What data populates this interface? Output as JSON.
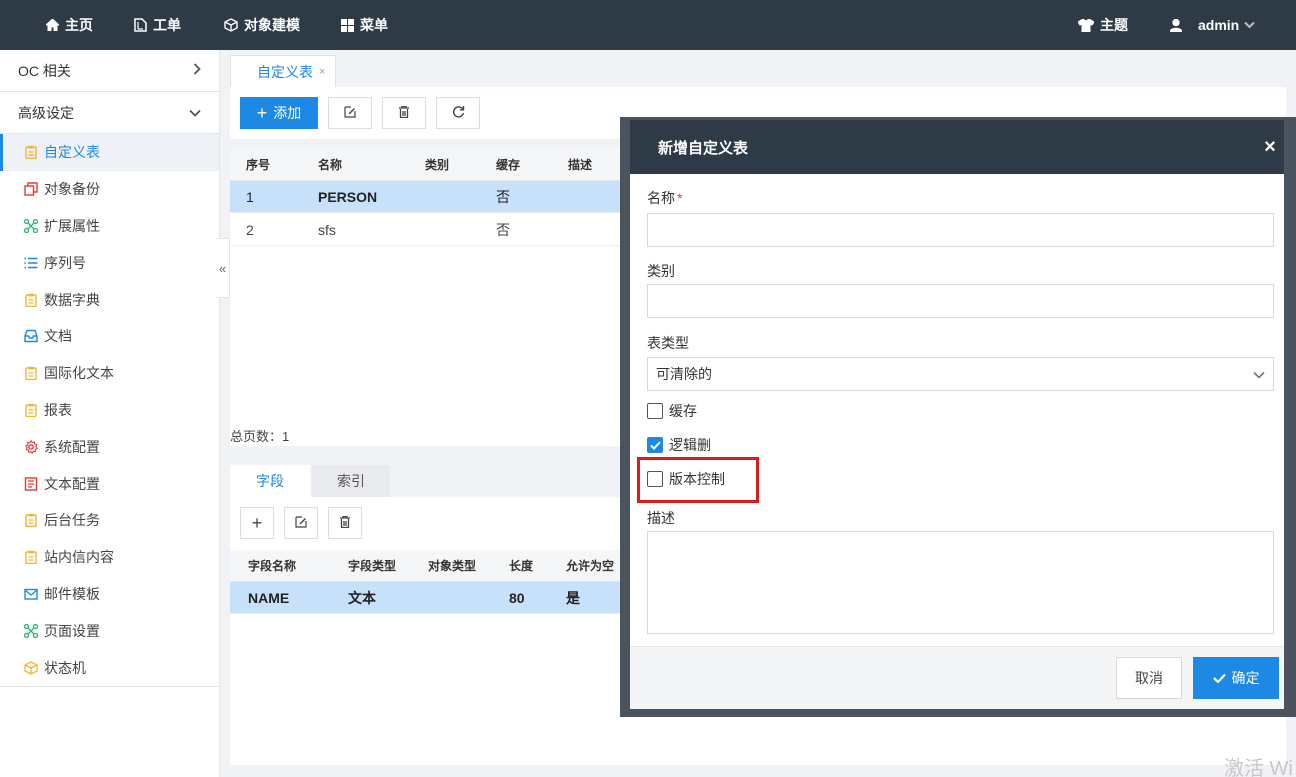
{
  "topnav": {
    "home": "主页",
    "workorder": "工单",
    "object_model": "对象建模",
    "menu": "菜单",
    "theme": "主题",
    "user": "admin"
  },
  "sidebar": {
    "group_oc": "OC 相关",
    "group_advanced": "高级设定",
    "items": [
      {
        "label": "自定义表",
        "icon": "clipboard-icon",
        "color": "#f5b335"
      },
      {
        "label": "对象备份",
        "icon": "copy-icon",
        "color": "#e53935"
      },
      {
        "label": "扩展属性",
        "icon": "network-icon",
        "color": "#2bb673"
      },
      {
        "label": "序列号",
        "icon": "list-icon",
        "color": "#1e88e5"
      },
      {
        "label": "数据字典",
        "icon": "clipboard-icon",
        "color": "#f5b335"
      },
      {
        "label": "文档",
        "icon": "inbox-icon",
        "color": "#1e88e5"
      },
      {
        "label": "国际化文本",
        "icon": "clipboard-icon",
        "color": "#f5b335"
      },
      {
        "label": "报表",
        "icon": "clipboard-icon",
        "color": "#f5b335"
      },
      {
        "label": "系统配置",
        "icon": "gear-icon",
        "color": "#e53935"
      },
      {
        "label": "文本配置",
        "icon": "doc-icon",
        "color": "#e53935"
      },
      {
        "label": "后台任务",
        "icon": "clipboard-icon",
        "color": "#f5b335"
      },
      {
        "label": "站内信内容",
        "icon": "clipboard-icon",
        "color": "#f5b335"
      },
      {
        "label": "邮件模板",
        "icon": "mail-icon",
        "color": "#1e88e5"
      },
      {
        "label": "页面设置",
        "icon": "network-icon",
        "color": "#2bb673"
      },
      {
        "label": "状态机",
        "icon": "cube-icon",
        "color": "#f5b335"
      }
    ]
  },
  "tab": {
    "label": "自定义表",
    "close": "×"
  },
  "toolbar": {
    "add": "添加"
  },
  "main_table": {
    "columns": [
      "序号",
      "名称",
      "类别",
      "缓存",
      "描述"
    ],
    "rows": [
      {
        "no": "1",
        "name": "PERSON",
        "category": "",
        "cache": "否",
        "desc": ""
      },
      {
        "no": "2",
        "name": "sfs",
        "category": "",
        "cache": "否",
        "desc": ""
      }
    ],
    "total_pages_label": "总页数：",
    "total_pages": "1"
  },
  "subtabs": {
    "fields": "字段",
    "index": "索引"
  },
  "field_table": {
    "columns": [
      "字段名称",
      "字段类型",
      "对象类型",
      "长度",
      "允许为空"
    ],
    "rows": [
      {
        "name": "NAME",
        "type": "文本",
        "object_type": "",
        "length": "80",
        "nullable": "是"
      }
    ]
  },
  "modal": {
    "title": "新增自定义表",
    "close": "×",
    "name_label": "名称",
    "required_mark": "*",
    "name_value": "",
    "category_label": "类别",
    "category_value": "",
    "table_type_label": "表类型",
    "table_type_value": "可清除的",
    "cache_label": "缓存",
    "cache_checked": false,
    "logical_delete_label": "逻辑删",
    "logical_delete_checked": true,
    "version_control_label": "版本控制",
    "version_control_checked": false,
    "desc_label": "描述",
    "desc_value": "",
    "cancel": "取消",
    "ok": "确定"
  },
  "watermark": "激活 Wi",
  "colors": {
    "primary": "#1e88e5",
    "nav_bg": "#2f3a47",
    "highlight": "#e0191f"
  }
}
